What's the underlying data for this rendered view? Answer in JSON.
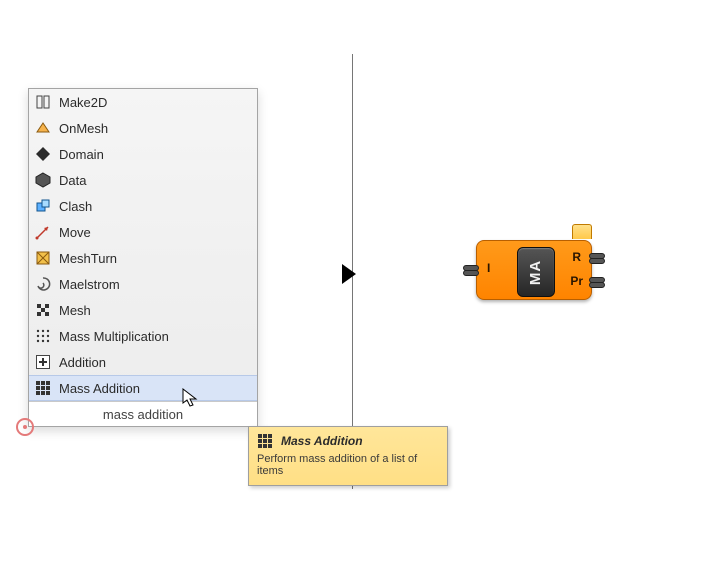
{
  "popup": {
    "items": [
      {
        "label": "Make2D",
        "icon": "make2d-icon"
      },
      {
        "label": "OnMesh",
        "icon": "onmesh-icon"
      },
      {
        "label": "Domain",
        "icon": "domain-icon"
      },
      {
        "label": "Data",
        "icon": "data-icon"
      },
      {
        "label": "Clash",
        "icon": "clash-icon"
      },
      {
        "label": "Move",
        "icon": "move-icon"
      },
      {
        "label": "MeshTurn",
        "icon": "meshturn-icon"
      },
      {
        "label": "Maelstrom",
        "icon": "maelstrom-icon"
      },
      {
        "label": "Mesh",
        "icon": "mesh-icon"
      },
      {
        "label": "Mass Multiplication",
        "icon": "massmul-icon"
      },
      {
        "label": "Addition",
        "icon": "addition-icon"
      },
      {
        "label": "Mass Addition",
        "icon": "massadd-icon"
      }
    ],
    "selected_index": 11,
    "search_text": "mass addition"
  },
  "tooltip": {
    "title": "Mass Addition",
    "desc": "Perform mass addition of a list of items"
  },
  "component": {
    "core": "MA",
    "in": {
      "I": "I"
    },
    "out": {
      "R": "R",
      "Pr": "Pr"
    }
  }
}
